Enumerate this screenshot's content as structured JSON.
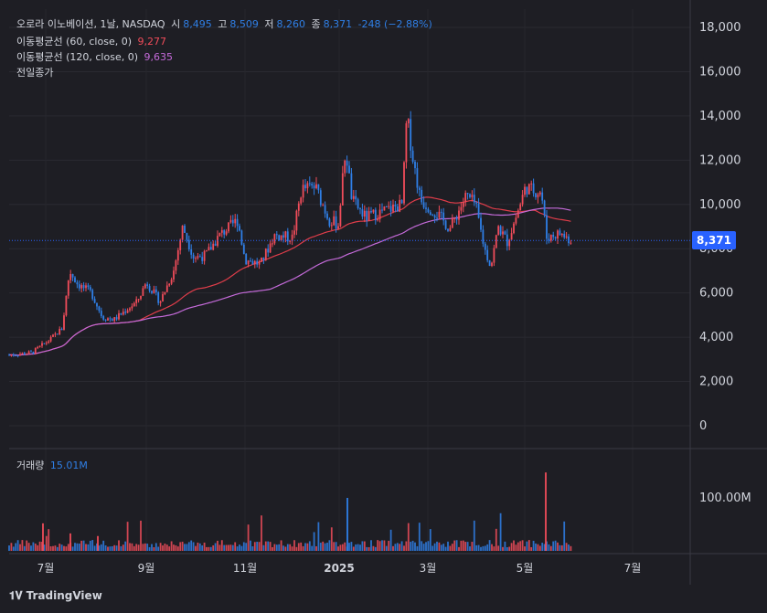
{
  "header": {
    "name": "오로라 이노베이션, 1날, NASDAQ",
    "open_label": "시",
    "open": "8,495",
    "high_label": "고",
    "high": "8,509",
    "low_label": "저",
    "low": "8,260",
    "close_label": "종",
    "close": "8,371",
    "change": "-248 (−2.88%)"
  },
  "indicators": {
    "ma60_label": "이동평균선 (60, close, 0)",
    "ma60_value": "9,277",
    "ma120_label": "이동평균선 (120, close, 0)",
    "ma120_value": "9,635",
    "prev_close_label": "전일종가"
  },
  "volume": {
    "label": "거래량",
    "value": "15.01M"
  },
  "last_price_tag": "8,371",
  "logo_text": "TradingView",
  "colors": {
    "up": "#f04c5a",
    "down": "#2f7fe6",
    "ma60": "#e03d4a",
    "ma120": "#c46ad9",
    "tag": "#2962ff",
    "bg": "#1e1e24"
  },
  "chart_data": {
    "type": "candlestick",
    "x_tick_labels": [
      "7월",
      "9월",
      "11월",
      "2025",
      "3월",
      "5월",
      "7월"
    ],
    "y_tick_labels": [
      "0",
      "2,000",
      "4,000",
      "6,000",
      "8,000",
      "10,000",
      "12,000",
      "14,000",
      "16,000",
      "18,000"
    ],
    "volume_tick_label": "100.00M",
    "ylim": [
      0,
      19000
    ],
    "price_series_approx": {
      "dates": [
        "2024-06",
        "2024-07",
        "2024-08",
        "2024-09",
        "2024-10",
        "2024-11",
        "2024-12",
        "2025-01",
        "2025-02",
        "2025-03",
        "2025-04",
        "2025-05",
        "2025-06"
      ],
      "close": [
        3200,
        6000,
        5000,
        7000,
        8000,
        7500,
        9000,
        10000,
        12000,
        9200,
        8000,
        10500,
        8371
      ]
    },
    "volume_peaks_millions": [
      {
        "date": "2025-01",
        "value": 100
      },
      {
        "date": "2025-05",
        "value": 148
      }
    ]
  }
}
